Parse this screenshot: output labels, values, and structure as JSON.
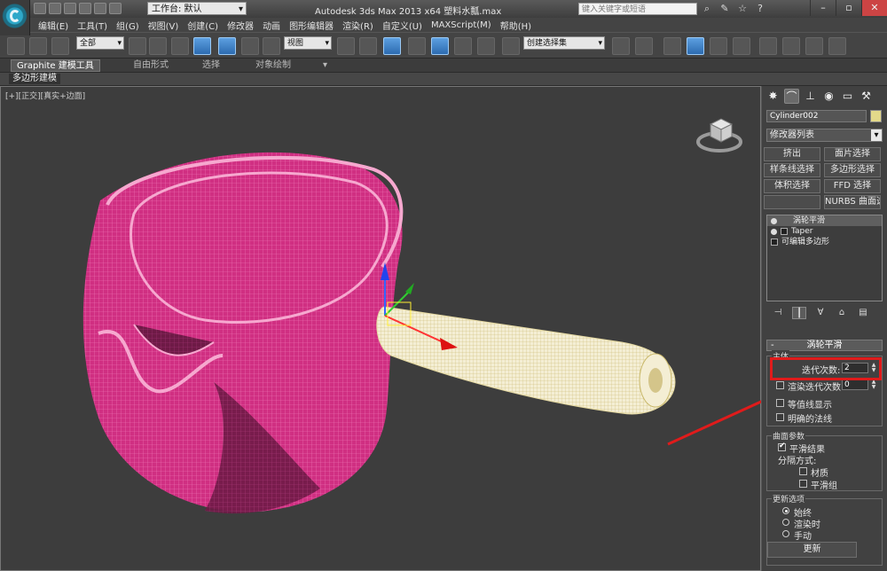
{
  "titlebar": {
    "workspace": "工作台: 默认",
    "title": "Autodesk 3ds Max  2013 x64      塑料水瓢.max",
    "search_placeholder": "键入关键字或短语"
  },
  "menu": [
    "编辑(E)",
    "工具(T)",
    "组(G)",
    "视图(V)",
    "创建(C)",
    "修改器",
    "动画",
    "图形编辑器",
    "渲染(R)",
    "自定义(U)",
    "MAXScript(M)",
    "帮助(H)"
  ],
  "toolbar": {
    "filter": "全部",
    "coord": "视图",
    "selection_set": "创建选择集"
  },
  "ribbon": {
    "tabs": [
      "Graphite 建模工具",
      "自由形式",
      "选择",
      "对象绘制"
    ],
    "subtab": "多边形建模"
  },
  "viewport": {
    "label": "[+][正交][真实+边面]"
  },
  "panel": {
    "object_name": "Cylinder002",
    "modifier_list": "修改器列表",
    "mod_buttons": [
      "挤出",
      "面片选择",
      "样条线选择",
      "多边形选择",
      "体积选择",
      "FFD 选择",
      "",
      "NURBS 曲面选择"
    ],
    "stack": [
      "涡轮平滑",
      "Taper",
      "可编辑多边形"
    ],
    "rollout_title": "涡轮平滑",
    "main_group": "主体",
    "iterations_label": "迭代次数:",
    "iterations_value": "2",
    "render_iters_label": "渲染迭代次数:",
    "render_iters_value": "0",
    "isoline": "等值线显示",
    "explicit_normals": "明确的法线",
    "surface_group": "曲面参数",
    "smooth_result": "平滑结果",
    "separate_by": "分隔方式:",
    "material": "材质",
    "smoothing_groups": "平滑组",
    "update_group": "更新选项",
    "always": "始终",
    "when_rendering": "渲染时",
    "manually": "手动",
    "update": "更新"
  },
  "colors": {
    "highlight": "#e01b1b",
    "accent": "#2c6bb0",
    "mesh": "#d43d8a"
  }
}
